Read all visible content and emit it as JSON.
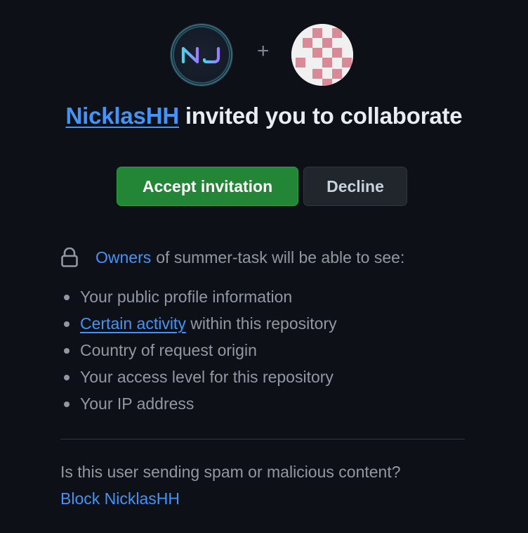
{
  "inviter": {
    "avatar_initials": "NJ",
    "username": "NicklasHH"
  },
  "invitee": {
    "avatar": "identicon"
  },
  "separator": "+",
  "headline": {
    "inviter_link": "NicklasHH",
    "text": " invited you to collaborate"
  },
  "actions": {
    "accept_label": "Accept invitation",
    "decline_label": "Decline"
  },
  "privacy": {
    "owners_link": "Owners",
    "notice_text": " of summer-task will be able to see:",
    "items": [
      {
        "text": "Your public profile information"
      },
      {
        "link": "Certain activity",
        "text": " within this repository"
      },
      {
        "text": "Country of request origin"
      },
      {
        "text": "Your access level for this repository"
      },
      {
        "text": "Your IP address"
      }
    ]
  },
  "spam": {
    "question": "Is this user sending spam or malicious content?",
    "block_link": "Block NicklasHH"
  },
  "colors": {
    "background": "#0d1117",
    "accent_link": "#4493f8",
    "accept_button": "#238636",
    "decline_button": "#21262d",
    "muted_text": "#9198a1",
    "identicon": "#d88b96"
  }
}
